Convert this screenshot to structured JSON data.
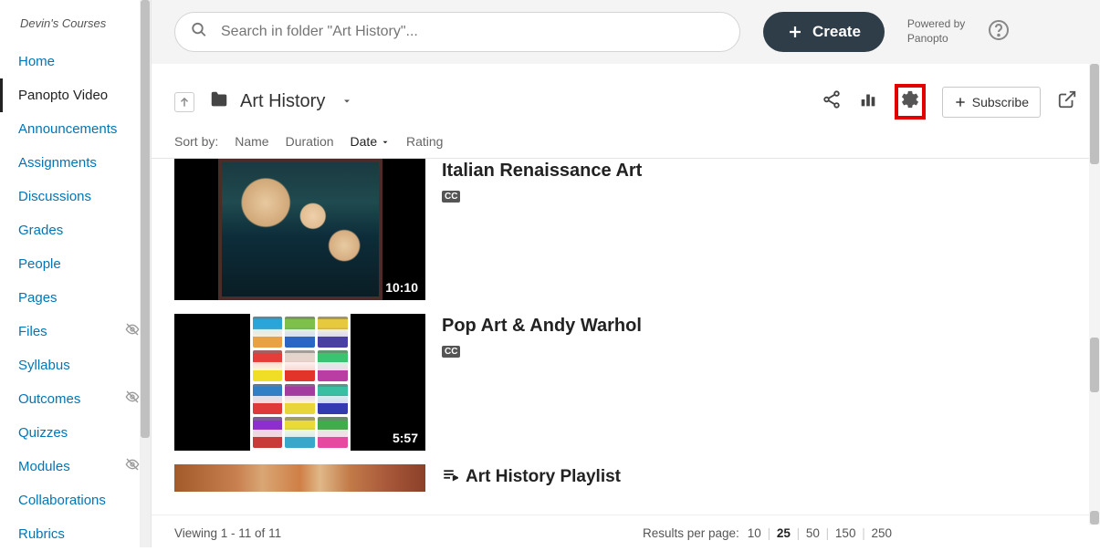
{
  "sidebar": {
    "courses_label": "Devin's Courses",
    "items": [
      {
        "label": "Home"
      },
      {
        "label": "Panopto Video",
        "active": true
      },
      {
        "label": "Announcements"
      },
      {
        "label": "Assignments"
      },
      {
        "label": "Discussions"
      },
      {
        "label": "Grades"
      },
      {
        "label": "People"
      },
      {
        "label": "Pages"
      },
      {
        "label": "Files",
        "hidden": true
      },
      {
        "label": "Syllabus"
      },
      {
        "label": "Outcomes",
        "hidden": true
      },
      {
        "label": "Quizzes"
      },
      {
        "label": "Modules",
        "hidden": true
      },
      {
        "label": "Collaborations"
      },
      {
        "label": "Rubrics"
      }
    ]
  },
  "topbar": {
    "search_placeholder": "Search in folder \"Art History\"...",
    "create_label": "Create",
    "powered_line1": "Powered by",
    "powered_line2": "Panopto"
  },
  "folder": {
    "name": "Art History",
    "subscribe_label": "Subscribe"
  },
  "sort": {
    "label": "Sort by:",
    "options": [
      "Name",
      "Duration",
      "Date",
      "Rating"
    ],
    "active": "Date"
  },
  "videos": [
    {
      "title": "Italian Renaissance Art",
      "duration": "10:10",
      "cc": "CC"
    },
    {
      "title": "Pop Art & Andy Warhol",
      "duration": "5:57",
      "cc": "CC"
    },
    {
      "title": "Art History Playlist",
      "playlist": true
    }
  ],
  "footer": {
    "viewing": "Viewing 1 - 11 of 11",
    "rpp_label": "Results per page:",
    "rpp_options": [
      "10",
      "25",
      "50",
      "150",
      "250"
    ],
    "rpp_active": "25"
  }
}
